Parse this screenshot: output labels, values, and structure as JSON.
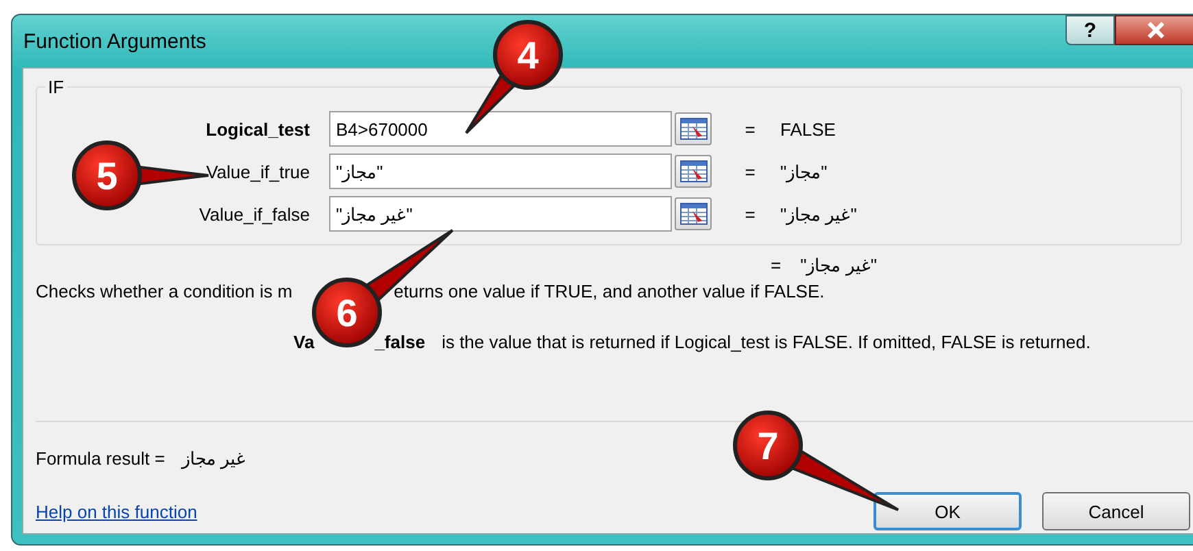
{
  "window": {
    "title": "Function Arguments",
    "help_button": "?"
  },
  "function_group": {
    "name": "IF",
    "arguments": [
      {
        "label": "Logical_test",
        "required": true,
        "value": "B4>670000",
        "equals": "=",
        "result": "FALSE"
      },
      {
        "label": "Value_if_true",
        "required": false,
        "value": "\"مجاز\"",
        "equals": "=",
        "result": "\"مجاز\""
      },
      {
        "label": "Value_if_false",
        "required": false,
        "value": "\"غير مجاز\"",
        "equals": "=",
        "result": "\"غير مجاز\""
      }
    ]
  },
  "overall": {
    "equals": "=",
    "result": "\"غير مجاز\""
  },
  "description": {
    "visible_start": "Checks whether a condition is m",
    "visible_end": "eturns one value if TRUE, and another value if FALSE."
  },
  "argument_help": {
    "name_start": "Va",
    "name_end": "_false",
    "text": "is the value that is returned if Logical_test is FALSE. If omitted, FALSE is returned."
  },
  "formula_result": {
    "label": "Formula result =",
    "value": "غير مجاز"
  },
  "help_link": "Help on this function",
  "ok_button": {
    "label": "OK",
    "selected": true
  },
  "cancel_button": {
    "label": "Cancel",
    "selected": false
  },
  "callouts": [
    {
      "number": "4"
    },
    {
      "number": "5"
    },
    {
      "number": "6"
    },
    {
      "number": "7"
    }
  ]
}
